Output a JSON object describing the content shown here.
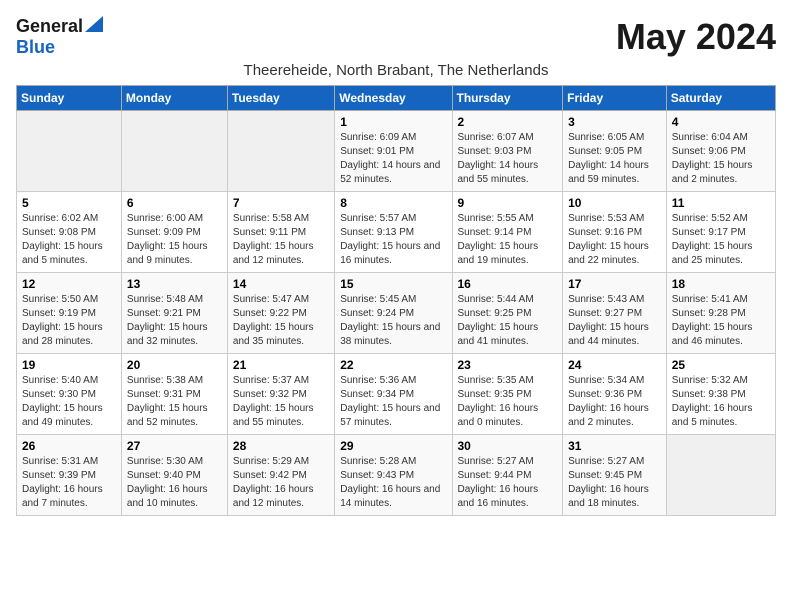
{
  "logo": {
    "general": "General",
    "blue": "Blue"
  },
  "title": "May 2024",
  "subtitle": "Theereheide, North Brabant, The Netherlands",
  "days_of_week": [
    "Sunday",
    "Monday",
    "Tuesday",
    "Wednesday",
    "Thursday",
    "Friday",
    "Saturday"
  ],
  "weeks": [
    [
      {
        "day": "",
        "info": ""
      },
      {
        "day": "",
        "info": ""
      },
      {
        "day": "",
        "info": ""
      },
      {
        "day": "1",
        "info": "Sunrise: 6:09 AM\nSunset: 9:01 PM\nDaylight: 14 hours and 52 minutes."
      },
      {
        "day": "2",
        "info": "Sunrise: 6:07 AM\nSunset: 9:03 PM\nDaylight: 14 hours and 55 minutes."
      },
      {
        "day": "3",
        "info": "Sunrise: 6:05 AM\nSunset: 9:05 PM\nDaylight: 14 hours and 59 minutes."
      },
      {
        "day": "4",
        "info": "Sunrise: 6:04 AM\nSunset: 9:06 PM\nDaylight: 15 hours and 2 minutes."
      }
    ],
    [
      {
        "day": "5",
        "info": "Sunrise: 6:02 AM\nSunset: 9:08 PM\nDaylight: 15 hours and 5 minutes."
      },
      {
        "day": "6",
        "info": "Sunrise: 6:00 AM\nSunset: 9:09 PM\nDaylight: 15 hours and 9 minutes."
      },
      {
        "day": "7",
        "info": "Sunrise: 5:58 AM\nSunset: 9:11 PM\nDaylight: 15 hours and 12 minutes."
      },
      {
        "day": "8",
        "info": "Sunrise: 5:57 AM\nSunset: 9:13 PM\nDaylight: 15 hours and 16 minutes."
      },
      {
        "day": "9",
        "info": "Sunrise: 5:55 AM\nSunset: 9:14 PM\nDaylight: 15 hours and 19 minutes."
      },
      {
        "day": "10",
        "info": "Sunrise: 5:53 AM\nSunset: 9:16 PM\nDaylight: 15 hours and 22 minutes."
      },
      {
        "day": "11",
        "info": "Sunrise: 5:52 AM\nSunset: 9:17 PM\nDaylight: 15 hours and 25 minutes."
      }
    ],
    [
      {
        "day": "12",
        "info": "Sunrise: 5:50 AM\nSunset: 9:19 PM\nDaylight: 15 hours and 28 minutes."
      },
      {
        "day": "13",
        "info": "Sunrise: 5:48 AM\nSunset: 9:21 PM\nDaylight: 15 hours and 32 minutes."
      },
      {
        "day": "14",
        "info": "Sunrise: 5:47 AM\nSunset: 9:22 PM\nDaylight: 15 hours and 35 minutes."
      },
      {
        "day": "15",
        "info": "Sunrise: 5:45 AM\nSunset: 9:24 PM\nDaylight: 15 hours and 38 minutes."
      },
      {
        "day": "16",
        "info": "Sunrise: 5:44 AM\nSunset: 9:25 PM\nDaylight: 15 hours and 41 minutes."
      },
      {
        "day": "17",
        "info": "Sunrise: 5:43 AM\nSunset: 9:27 PM\nDaylight: 15 hours and 44 minutes."
      },
      {
        "day": "18",
        "info": "Sunrise: 5:41 AM\nSunset: 9:28 PM\nDaylight: 15 hours and 46 minutes."
      }
    ],
    [
      {
        "day": "19",
        "info": "Sunrise: 5:40 AM\nSunset: 9:30 PM\nDaylight: 15 hours and 49 minutes."
      },
      {
        "day": "20",
        "info": "Sunrise: 5:38 AM\nSunset: 9:31 PM\nDaylight: 15 hours and 52 minutes."
      },
      {
        "day": "21",
        "info": "Sunrise: 5:37 AM\nSunset: 9:32 PM\nDaylight: 15 hours and 55 minutes."
      },
      {
        "day": "22",
        "info": "Sunrise: 5:36 AM\nSunset: 9:34 PM\nDaylight: 15 hours and 57 minutes."
      },
      {
        "day": "23",
        "info": "Sunrise: 5:35 AM\nSunset: 9:35 PM\nDaylight: 16 hours and 0 minutes."
      },
      {
        "day": "24",
        "info": "Sunrise: 5:34 AM\nSunset: 9:36 PM\nDaylight: 16 hours and 2 minutes."
      },
      {
        "day": "25",
        "info": "Sunrise: 5:32 AM\nSunset: 9:38 PM\nDaylight: 16 hours and 5 minutes."
      }
    ],
    [
      {
        "day": "26",
        "info": "Sunrise: 5:31 AM\nSunset: 9:39 PM\nDaylight: 16 hours and 7 minutes."
      },
      {
        "day": "27",
        "info": "Sunrise: 5:30 AM\nSunset: 9:40 PM\nDaylight: 16 hours and 10 minutes."
      },
      {
        "day": "28",
        "info": "Sunrise: 5:29 AM\nSunset: 9:42 PM\nDaylight: 16 hours and 12 minutes."
      },
      {
        "day": "29",
        "info": "Sunrise: 5:28 AM\nSunset: 9:43 PM\nDaylight: 16 hours and 14 minutes."
      },
      {
        "day": "30",
        "info": "Sunrise: 5:27 AM\nSunset: 9:44 PM\nDaylight: 16 hours and 16 minutes."
      },
      {
        "day": "31",
        "info": "Sunrise: 5:27 AM\nSunset: 9:45 PM\nDaylight: 16 hours and 18 minutes."
      },
      {
        "day": "",
        "info": ""
      }
    ]
  ]
}
